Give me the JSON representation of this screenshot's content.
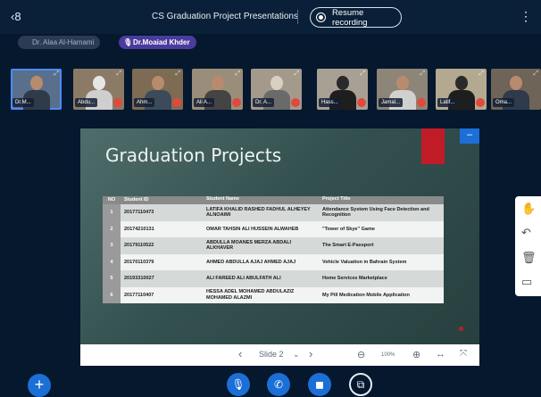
{
  "header": {
    "title": "CS Graduation Project Presentations",
    "recording_label": "Resume recording"
  },
  "talkers": [
    {
      "name": "Dr. Alaa Al-Hamami"
    },
    {
      "name": "Dr.Moaiad Khder"
    }
  ],
  "participants": [
    {
      "label": "Dr.M..."
    },
    {
      "label": "Abdu..."
    },
    {
      "label": "Ahm..."
    },
    {
      "label": "Ali A..."
    },
    {
      "label": "Dr. A..."
    },
    {
      "label": "Hass..."
    },
    {
      "label": "Jamal..."
    },
    {
      "label": "Latif..."
    },
    {
      "label": "Oma..."
    }
  ],
  "slide": {
    "title": "Graduation Projects",
    "table": {
      "headers": [
        "NO",
        "Student ID",
        "Student Name",
        "Project Title"
      ],
      "rows": [
        [
          "1",
          "20177110473",
          "LATIFA KHALID RASHED FADHUL ALHEYEY ALNOAIMI",
          "Attendance System Using Face Detection and Recognition"
        ],
        [
          "2",
          "20174210131",
          "OMAR TAHSIN ALI HUSSEIN ALWAHEB",
          "\"Tower of Skye\" Game"
        ],
        [
          "3",
          "20179110522",
          "ABDULLA MOANES MERZA ABDALI ALKHAVER",
          "The Smart E-Passport"
        ],
        [
          "4",
          "20170110379",
          "AHMED ABDULLA AJAJ AHMED AJAJ",
          "Vehicle Valuation in Bahrain System"
        ],
        [
          "5",
          "20193310027",
          "ALI FAREED ALI ABULFATH ALI",
          "Home Services Marketplace"
        ],
        [
          "6",
          "20177110407",
          "HESSA ADEL MOHAMED ABDULAZIZ MOHAMED ALAZMI",
          "My Pill Medication Mobile Application"
        ]
      ]
    }
  },
  "slide_nav": {
    "prev": "‹",
    "current": "Slide 2",
    "chevron": "⌄",
    "next": "›",
    "zoom_out": "⊖",
    "zoom": "100%",
    "zoom_in": "⊕",
    "fit_width": "↔",
    "fullscreen": "⤧"
  },
  "icons": {
    "users": "‹8",
    "kebab": "⋮",
    "rec": "",
    "plus": "+",
    "mic": "🎙",
    "phone": "✆",
    "camera": "◼",
    "share": "⧉",
    "hand": "✋",
    "undo": "↶",
    "trash": "🗑",
    "whiteboard": "▭",
    "minimize": "–",
    "talker_mic": "🎙"
  }
}
